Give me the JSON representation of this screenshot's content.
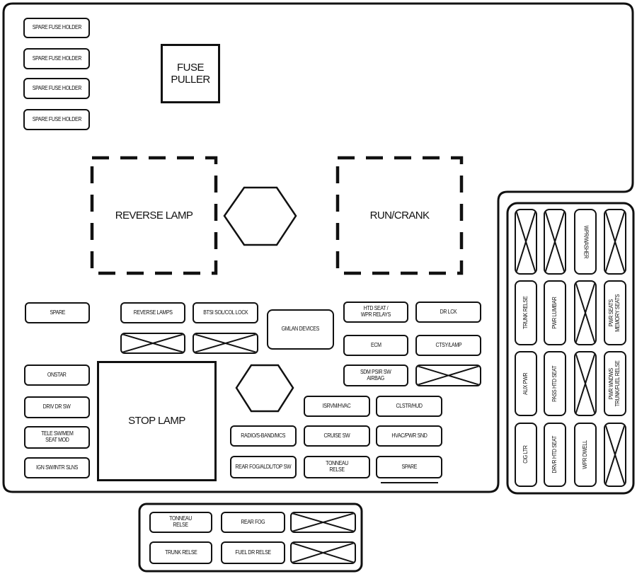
{
  "main_panel": {
    "spare_fuse_holders": [
      "SPARE FUSE HOLDER",
      "SPARE FUSE HOLDER",
      "SPARE FUSE HOLDER",
      "SPARE FUSE HOLDER"
    ],
    "fuse_puller": "FUSE\nPULLER",
    "relays": {
      "reverse_lamp": "REVERSE LAMP",
      "run_crank": "RUN/CRANK",
      "stop_lamp": "STOP LAMP"
    },
    "gmlan_devices": "GMLAN DEVICES",
    "fuses": {
      "spare_1": "SPARE",
      "reverse_lamps": "REVERSE LAMPS",
      "btsi": "BTSI SOL/COL LOCK",
      "htd_seat_wpr_relays": "HTD SEAT /\nWPR RELAYS",
      "dr_lck": "DR LCK",
      "ecm": "ECM",
      "ctsy_lamp": "CTSY/LAMP",
      "sdm_airbag": "SDM PSIR SW\nAIRBAG",
      "onstar": "ONSTAR",
      "driv_dr_sw": "DRIV DR SW",
      "tele_sw_mem": "TELE SW/MEM\nSEAT MOD",
      "ign_sw": "IGN SW/INTR SLNS",
      "isrvm_hvac": "ISRVM/HVAC",
      "clstr_hud": "CLSTR/HUD",
      "radio": "RADIO/S-BAND/MCS",
      "cruise_sw": "CRUISE SW",
      "hvac_pwr_snd": "HVAC/PWR SND",
      "rear_fog": "REAR FOG/ALDL/TOP SW",
      "tonneau_relse": "TONNEAU\nRELSE",
      "spare_2": "SPARE"
    }
  },
  "right_panel": {
    "rows": [
      [
        "",
        "",
        "WPR/WASHER",
        ""
      ],
      [
        "TRUNK RELSE",
        "PWR LUMBAR",
        "",
        "PWR SEATS\nMEMORY SEATS"
      ],
      [
        "AUX PWR",
        "PASS HTD SEAT",
        "",
        "PWR WNDWS\nTRUNK/FUEL RELSE"
      ],
      [
        "CIG LTR",
        "DRVR HTD SEAT",
        "WPR DWELL",
        ""
      ]
    ]
  },
  "bottom_panel": {
    "rows": [
      [
        "TONNEAU\nRELSE",
        "REAR FOG",
        ""
      ],
      [
        "TRUNK RELSE",
        "FUEL DR RELSE",
        ""
      ]
    ]
  },
  "symbols": {
    "empty_slot": "crossed-box",
    "mount_point": "hexagon"
  }
}
